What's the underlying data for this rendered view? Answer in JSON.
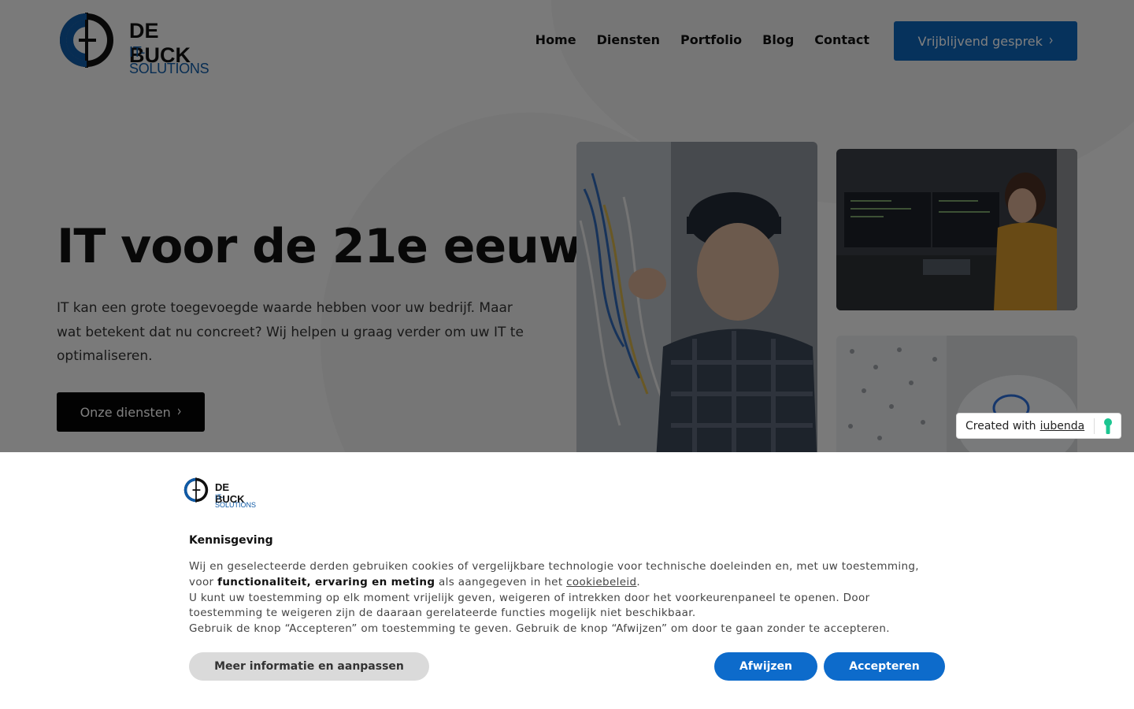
{
  "header": {
    "logo": {
      "name": "DE BUCK",
      "sub": "IT-SOLUTIONS"
    },
    "nav": [
      "Home",
      "Diensten",
      "Portfolio",
      "Blog",
      "Contact"
    ],
    "cta_label": "Vrijblijvend gesprek",
    "cta_icon": "chevron-right-icon"
  },
  "hero": {
    "title": "IT voor de 21e eeuw",
    "text": "IT kan een grote toegevoegde waarde hebben voor uw bedrijf. Maar wat betekent dat nu concreet? Wij helpen u graag verder om uw IT te optimaliseren.",
    "button_label": "Onze diensten",
    "button_icon": "chevron-right-icon"
  },
  "iubenda_badge": {
    "text": "Created with",
    "link": "iubenda",
    "icon": "keyhole-icon"
  },
  "cookie_banner": {
    "logo": {
      "name": "DE BUCK",
      "sub": "IT-SOLUTIONS"
    },
    "title": "Kennisgeving",
    "p1_pre": "Wij en geselecteerde derden gebruiken cookies of vergelijkbare technologie voor technische doeleinden en, met uw toestemming, voor",
    "p1_bold": "functionaliteit, ervaring en meting",
    "p1_mid": "als aangegeven in het",
    "p1_link": "cookiebeleid",
    "p1_end": ".",
    "p2": "U kunt uw toestemming op elk moment vrijelijk geven, weigeren of intrekken door het voorkeurenpaneel te openen. Door toestemming te weigeren zijn de daaraan gerelateerde functies mogelijk niet beschikbaar.",
    "p3": "Gebruik de knop “Accepteren” om toestemming te geven. Gebruik de knop “Afwijzen” om door te gaan zonder te accepteren.",
    "more_label": "Meer informatie en aanpassen",
    "reject_label": "Afwijzen",
    "accept_label": "Accepteren"
  },
  "colors": {
    "brand_blue": "#0d64b8",
    "button_blue": "#0d6bcb",
    "overlay": "rgba(0,0,0,0.5)"
  }
}
